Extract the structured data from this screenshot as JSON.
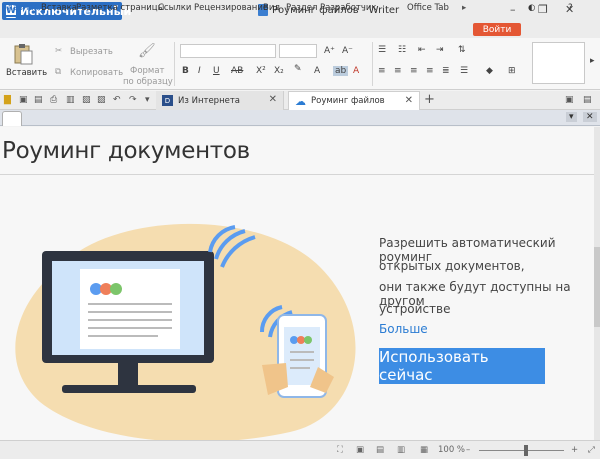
{
  "app": {
    "brand": "Исключительный",
    "window_title": "Роуминг файлов - Writer"
  },
  "menu": [
    "Главная",
    "Вставка",
    "Разметка страницы",
    "Ссылки",
    "Рецензирование",
    "Вид",
    "Раздел",
    "Разработчик",
    "Office Tab"
  ],
  "enter_label": "Войти",
  "ribbon": {
    "paste": "Вставить",
    "cut": "Вырезать",
    "copy": "Копировать",
    "format_painter_1": "Формат",
    "format_painter_2": "по образцу",
    "bold": "B",
    "italic": "I",
    "underline": "U",
    "strike": "AB",
    "sup": "X²",
    "sub": "X₂",
    "font_color": "A"
  },
  "tabs": [
    {
      "label": "Из Интернета"
    },
    {
      "label": "Роуминг файлов"
    }
  ],
  "page": {
    "title": "Роуминг документов",
    "desc_lines": [
      "Разрешить автоматический роуминг",
      "открытых документов,",
      "они также будут доступны на другом",
      "устройстве"
    ],
    "more": "Больше",
    "use_now": "Использовать сейчас"
  },
  "status": {
    "zoom": "100 %"
  },
  "colors": {
    "accent": "#2b6fc4",
    "enter": "#e45734",
    "button": "#3d8de4",
    "blob": "#f5ddb0"
  }
}
